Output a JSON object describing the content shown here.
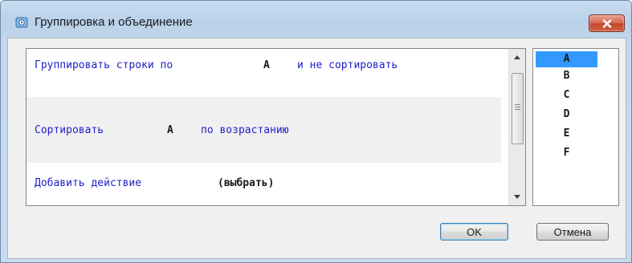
{
  "window": {
    "title": "Группировка и объединение",
    "close_icon": "close-x-icon",
    "app_icon": "dialog-app-icon"
  },
  "rules": [
    {
      "parts": [
        "Группировать строки по",
        "A",
        "и не сортировать"
      ]
    },
    {
      "parts": [
        "Сортировать",
        "A",
        "по возрастанию"
      ]
    },
    {
      "parts": [
        "Добавить действие",
        "(выбрать)"
      ]
    }
  ],
  "letters": {
    "items": [
      "A",
      "B",
      "C",
      "D",
      "E",
      "F"
    ],
    "selected": "A"
  },
  "buttons": {
    "ok": "OK",
    "cancel": "Отмена"
  },
  "colors": {
    "link_text": "#2020c8",
    "selection": "#3399ff",
    "close_button": "#c9533b"
  }
}
